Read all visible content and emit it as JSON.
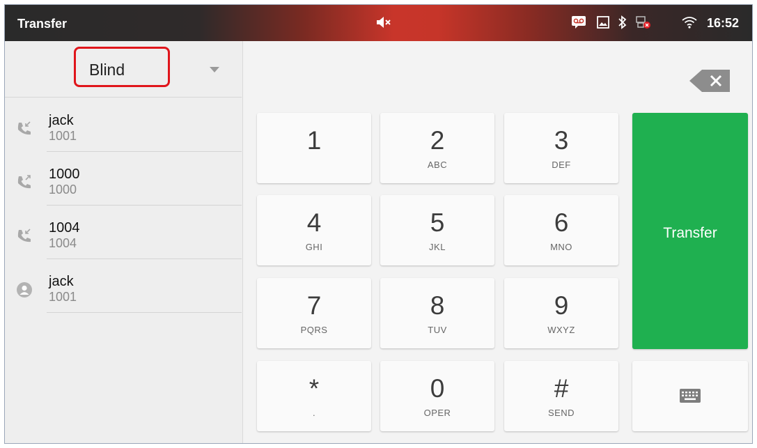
{
  "status_bar": {
    "title": "Transfer",
    "time": "16:52",
    "icons": [
      "mute-icon",
      "voicemail-icon",
      "image-icon",
      "bluetooth-icon",
      "network-icon",
      "wifi-icon"
    ]
  },
  "transfer_mode": {
    "selected": "Blind"
  },
  "contacts": [
    {
      "name": "jack",
      "number": "1001",
      "icon": "incoming-call-icon"
    },
    {
      "name": "1000",
      "number": "1000",
      "icon": "outgoing-call-icon"
    },
    {
      "name": "1004",
      "number": "1004",
      "icon": "incoming-call-icon"
    },
    {
      "name": "jack",
      "number": "1001",
      "icon": "contact-avatar-icon"
    }
  ],
  "keypad": [
    {
      "digit": "1",
      "letters": ""
    },
    {
      "digit": "2",
      "letters": "ABC"
    },
    {
      "digit": "3",
      "letters": "DEF"
    },
    {
      "digit": "4",
      "letters": "GHI"
    },
    {
      "digit": "5",
      "letters": "JKL"
    },
    {
      "digit": "6",
      "letters": "MNO"
    },
    {
      "digit": "7",
      "letters": "PQRS"
    },
    {
      "digit": "8",
      "letters": "TUV"
    },
    {
      "digit": "9",
      "letters": "WXYZ"
    },
    {
      "digit": "*",
      "letters": "."
    },
    {
      "digit": "0",
      "letters": "OPER"
    },
    {
      "digit": "#",
      "letters": "SEND"
    }
  ],
  "actions": {
    "transfer_label": "Transfer",
    "keyboard_icon": "keyboard-icon",
    "backspace_icon": "backspace-icon"
  },
  "colors": {
    "transfer_green": "#1fb050",
    "highlight_red": "#e0151b"
  }
}
